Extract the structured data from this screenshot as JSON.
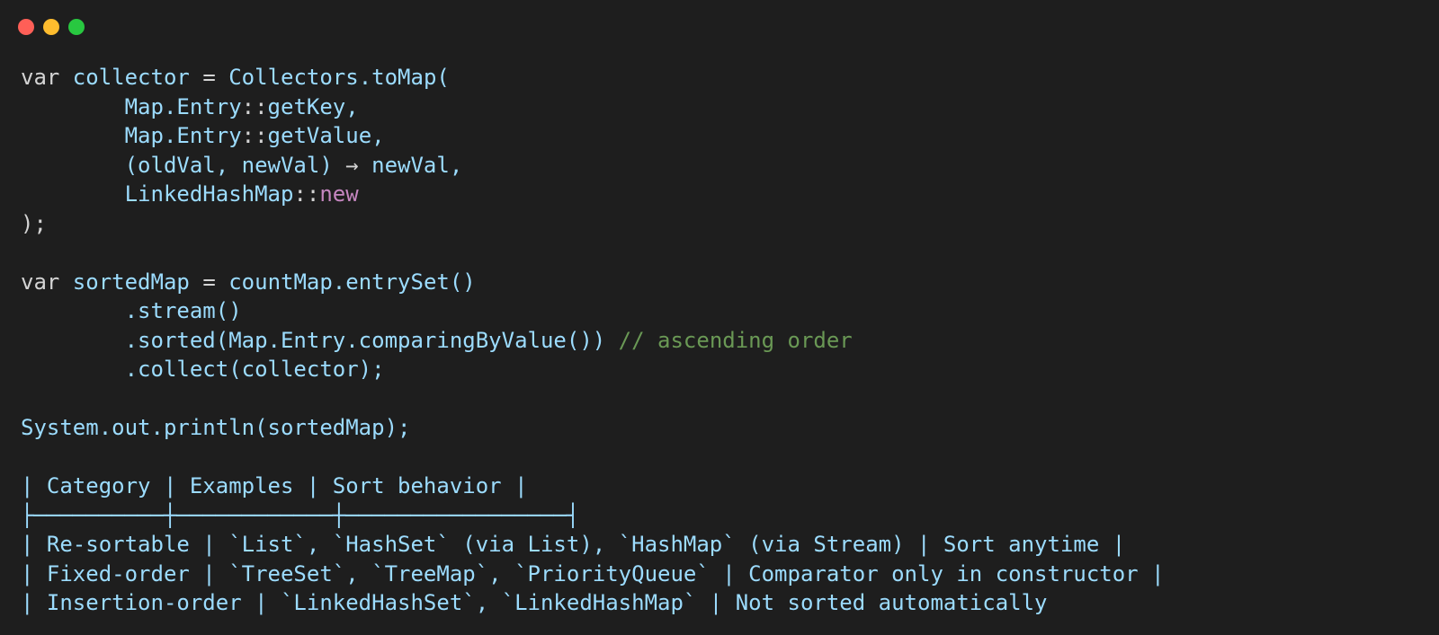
{
  "window": {
    "controls": [
      {
        "name": "close",
        "color": "#ff5f57"
      },
      {
        "name": "minimize",
        "color": "#febc2e"
      },
      {
        "name": "maximize",
        "color": "#28c840"
      }
    ]
  },
  "theme": {
    "background": "#1e1e1e",
    "identifier": "#9cdcfe",
    "keyword": "#d4d4d4",
    "new_keyword": "#c586c0",
    "comment": "#6a9955"
  },
  "code_lines": [
    [
      {
        "t": "var",
        "k": "kw"
      },
      {
        "t": " collector ",
        "k": "id"
      },
      {
        "t": "=",
        "k": "pu"
      },
      {
        "t": " Collectors.toMap(",
        "k": "id"
      }
    ],
    [
      {
        "t": "        Map.Entry",
        "k": "id"
      },
      {
        "t": "::",
        "k": "pu"
      },
      {
        "t": "getKey,",
        "k": "id"
      }
    ],
    [
      {
        "t": "        Map.Entry",
        "k": "id"
      },
      {
        "t": "::",
        "k": "pu"
      },
      {
        "t": "getValue,",
        "k": "id"
      }
    ],
    [
      {
        "t": "        (oldVal, newVal) ",
        "k": "id"
      },
      {
        "t": "→",
        "k": "pu"
      },
      {
        "t": " newVal,",
        "k": "id"
      }
    ],
    [
      {
        "t": "        LinkedHashMap",
        "k": "id"
      },
      {
        "t": "::",
        "k": "pu"
      },
      {
        "t": "new",
        "k": "new"
      }
    ],
    [
      {
        "t": ");",
        "k": "pu"
      }
    ],
    [],
    [
      {
        "t": "var",
        "k": "kw"
      },
      {
        "t": " sortedMap ",
        "k": "id"
      },
      {
        "t": "=",
        "k": "pu"
      },
      {
        "t": " countMap.entrySet()",
        "k": "id"
      }
    ],
    [
      {
        "t": "        .stream()",
        "k": "id"
      }
    ],
    [
      {
        "t": "        .sorted(Map.Entry.comparingByValue()) ",
        "k": "id"
      },
      {
        "t": "// ascending order",
        "k": "cm"
      }
    ],
    [
      {
        "t": "        .collect(collector);",
        "k": "id"
      }
    ],
    [],
    [
      {
        "t": "System.out.println(sortedMap);",
        "k": "id"
      }
    ],
    [],
    [
      {
        "t": "| Category | Examples | Sort behavior |",
        "k": "tb"
      }
    ],
    [
      {
        "t": "├──────────┼────────────┼─────────────────┤",
        "k": "tb"
      }
    ],
    [
      {
        "t": "| Re-sortable | `List`, `HashSet` (via List), `HashMap` (via Stream) | Sort anytime |",
        "k": "tb"
      }
    ],
    [
      {
        "t": "| Fixed-order | `TreeSet`, `TreeMap`, `PriorityQueue` | Comparator only in constructor |",
        "k": "tb"
      }
    ],
    [
      {
        "t": "| Insertion-order | `LinkedHashSet`, `LinkedHashMap` | Not sorted automatically",
        "k": "tb"
      }
    ]
  ]
}
